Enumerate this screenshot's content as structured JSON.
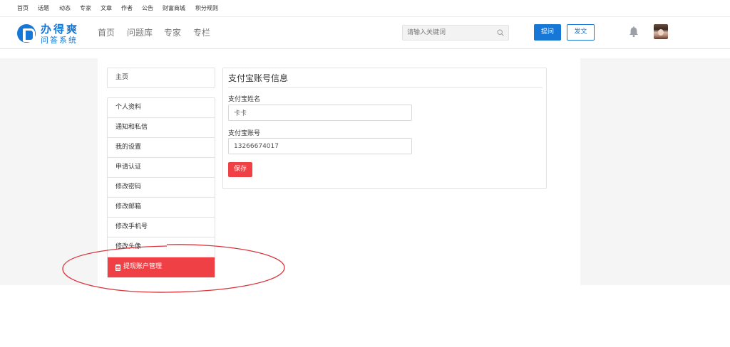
{
  "topnav": [
    "首页",
    "话题",
    "动态",
    "专家",
    "文章",
    "作者",
    "公告",
    "财富商城",
    "积分规则"
  ],
  "logo": {
    "main": "办得爽",
    "sub": "问答系统"
  },
  "mainnav": [
    "首页",
    "问题库",
    "专家",
    "专栏"
  ],
  "search": {
    "placeholder": "请输入关键词"
  },
  "header_buttons": {
    "ask": "提问",
    "post": "发文"
  },
  "sidebar": {
    "home": "主页",
    "items": [
      "个人资料",
      "通知和私信",
      "我的设置",
      "申请认证",
      "修改密码",
      "修改邮箱",
      "修改手机号",
      "修改头像",
      "提现账户管理"
    ]
  },
  "panel": {
    "title": "支付宝账号信息",
    "name_label": "支付宝姓名",
    "name_value": "卡卡",
    "account_label": "支付宝账号",
    "account_value": "13266674017",
    "save": "保存"
  },
  "colors": {
    "brand": "#1677d6",
    "accent": "#ef4045",
    "annotation": "#d9363e"
  },
  "icons": [
    "search-icon",
    "bell-icon",
    "document-icon",
    "logo-thumb-icon"
  ]
}
